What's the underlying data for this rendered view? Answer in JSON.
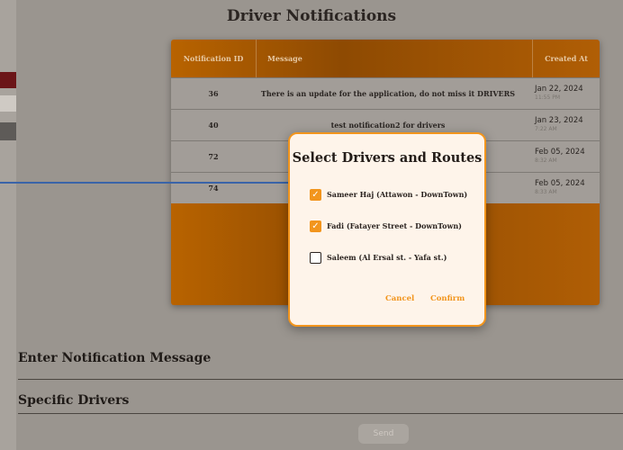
{
  "page": {
    "title": "Driver Notifications"
  },
  "table": {
    "headers": {
      "id": "Notification ID",
      "message": "Message",
      "created": "Created At"
    },
    "rows": [
      {
        "id": "36",
        "message": "There is an update for the application, do not miss it DRIVERS",
        "date": "Jan 22, 2024",
        "time": "11:55 PM"
      },
      {
        "id": "40",
        "message": "test notification2 for drivers",
        "date": "Jan 23, 2024",
        "time": "7:22 AM"
      },
      {
        "id": "72",
        "message": "",
        "date": "Feb 05, 2024",
        "time": "8:32 AM"
      },
      {
        "id": "74",
        "message": "",
        "date": "Feb 05, 2024",
        "time": "8:33 AM"
      }
    ]
  },
  "modal": {
    "title": "Select Drivers and Routes",
    "options": [
      {
        "label": "Sameer Haj (Attawon - DownTown)",
        "checked": true
      },
      {
        "label": "Fadi (Fatayer Street - DownTown)",
        "checked": true
      },
      {
        "label": "Saleem (Al Ersal st. - Yafa st.)",
        "checked": false
      }
    ],
    "cancel": "Cancel",
    "confirm": "Confirm"
  },
  "form": {
    "message_label": "Enter Notification Message",
    "drivers_label": "Specific Drivers",
    "send": "Send"
  },
  "colors": {
    "accent": "#f2951d",
    "table_orange": "#b86300",
    "arrow": "#3a64a8"
  }
}
